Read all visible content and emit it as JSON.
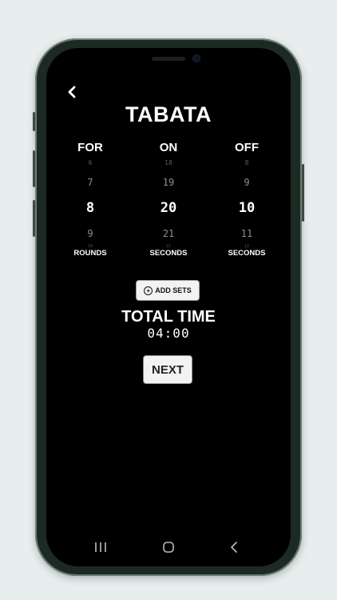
{
  "app": {
    "title": "TABATA"
  },
  "columns": [
    {
      "header": "FOR",
      "values": [
        "6",
        "7",
        "8",
        "9",
        "10"
      ],
      "selected": "8",
      "unit": "ROUNDS"
    },
    {
      "header": "ON",
      "values": [
        "18",
        "19",
        "20",
        "21",
        "22"
      ],
      "selected": "20",
      "unit": "SECONDS"
    },
    {
      "header": "OFF",
      "values": [
        "8",
        "9",
        "10",
        "11",
        "12"
      ],
      "selected": "10",
      "unit": "SECONDS"
    }
  ],
  "actions": {
    "add_sets": "ADD SETS",
    "next": "NEXT"
  },
  "total": {
    "label": "TOTAL TIME",
    "value": "04:00"
  },
  "icons": {
    "back": "chevron-left-icon",
    "add": "plus-circle-icon",
    "nav_recents": "recents-icon",
    "nav_home": "home-icon",
    "nav_back": "back-icon"
  }
}
